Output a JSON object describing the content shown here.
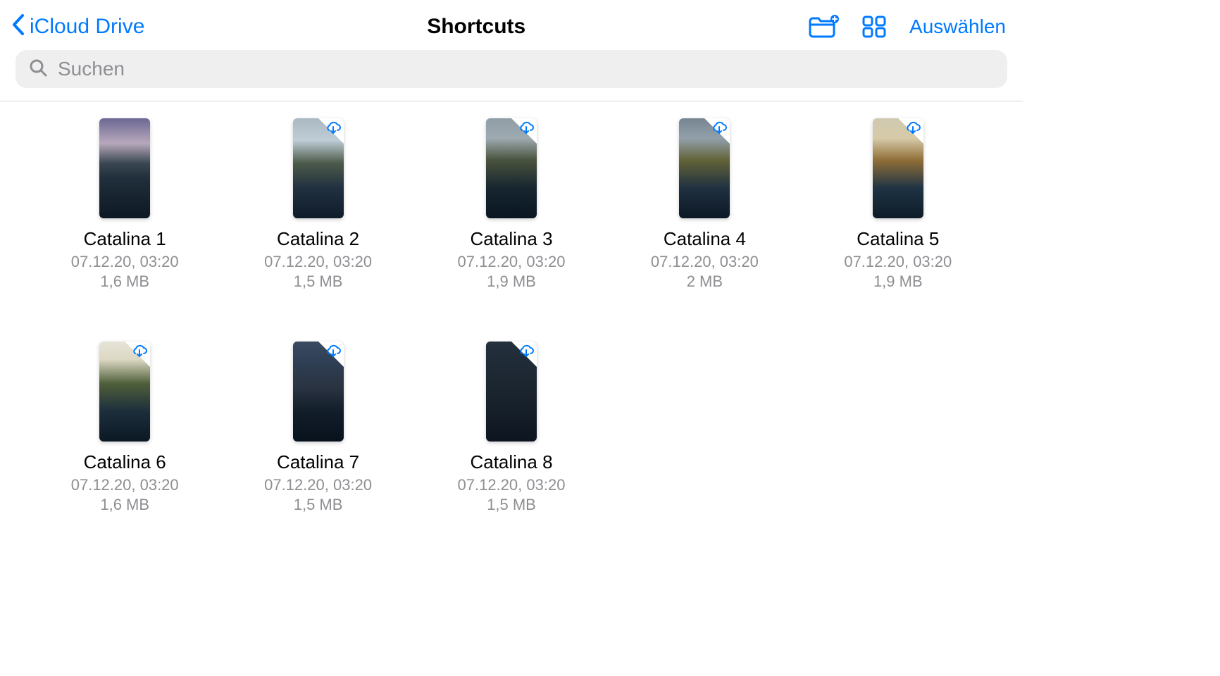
{
  "nav": {
    "back_label": "iCloud Drive",
    "title": "Shortcuts",
    "select_label": "Auswählen"
  },
  "search": {
    "placeholder": "Suchen"
  },
  "files": [
    {
      "name": "Catalina 1",
      "meta": "07.12.20, 03:20",
      "size": "1,6 MB",
      "cloud": false,
      "thumb": "sky-dusk"
    },
    {
      "name": "Catalina 2",
      "meta": "07.12.20, 03:20",
      "size": "1,5 MB",
      "cloud": true,
      "thumb": "sky-day"
    },
    {
      "name": "Catalina 3",
      "meta": "07.12.20, 03:20",
      "size": "1,9 MB",
      "cloud": true,
      "thumb": "sky-storm1"
    },
    {
      "name": "Catalina 4",
      "meta": "07.12.20, 03:20",
      "size": "2 MB",
      "cloud": true,
      "thumb": "sky-storm2"
    },
    {
      "name": "Catalina 5",
      "meta": "07.12.20, 03:20",
      "size": "1,9 MB",
      "cloud": true,
      "thumb": "sky-gold1"
    },
    {
      "name": "Catalina 6",
      "meta": "07.12.20, 03:20",
      "size": "1,6 MB",
      "cloud": true,
      "thumb": "sky-green"
    },
    {
      "name": "Catalina 7",
      "meta": "07.12.20, 03:20",
      "size": "1,5 MB",
      "cloud": true,
      "thumb": "sky-night"
    },
    {
      "name": "Catalina 8",
      "meta": "07.12.20, 03:20",
      "size": "1,5 MB",
      "cloud": true,
      "thumb": "sky-dark"
    }
  ]
}
